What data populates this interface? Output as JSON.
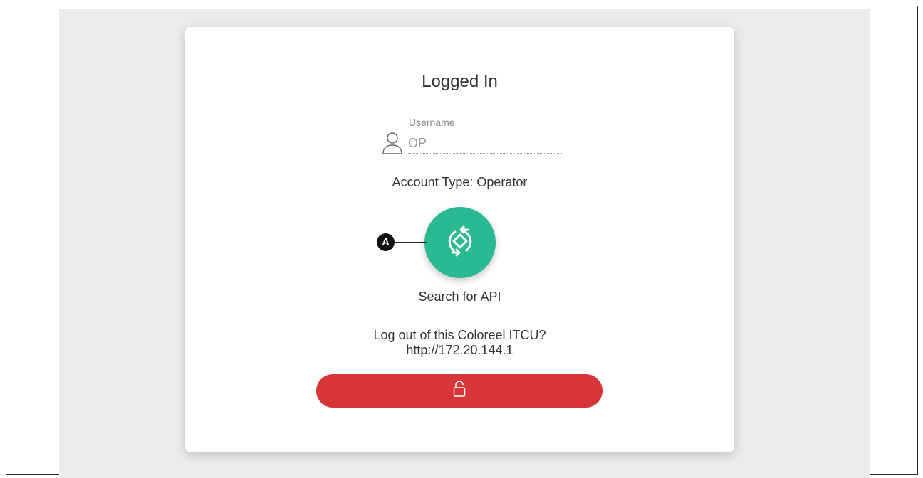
{
  "login_panel": {
    "title": "Logged In",
    "username_label": "Username",
    "username_value": "OP",
    "account_type": "Account Type: Operator",
    "search_api_label": "Search for API",
    "logout_question": "Log out of this Coloreel ITCU?",
    "logout_url": "http://172.20.144.1"
  },
  "icons": {
    "user": "user-icon",
    "api_search": "sync-diamond-icon",
    "logout": "lock-icon"
  },
  "callout": {
    "label": "A"
  },
  "colors": {
    "api_button": "#2bb993",
    "logout_button": "#d63638",
    "background_panel": "#ebebeb"
  }
}
